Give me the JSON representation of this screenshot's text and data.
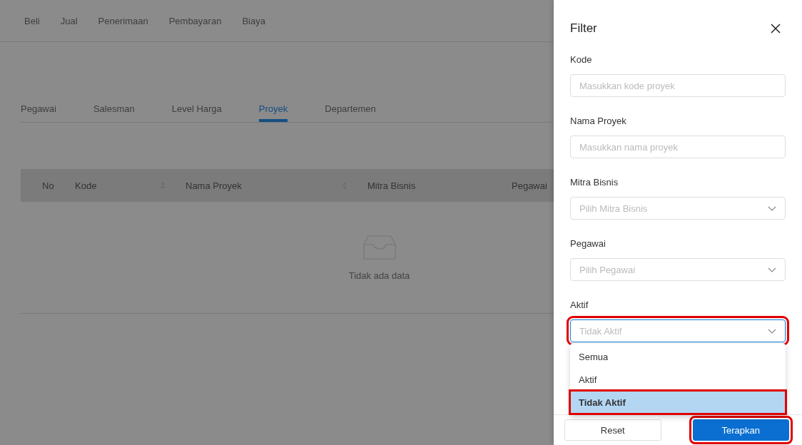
{
  "top_nav": [
    {
      "label": "Beli"
    },
    {
      "label": "Jual"
    },
    {
      "label": "Penerimaan"
    },
    {
      "label": "Pembayaran"
    },
    {
      "label": "Biaya"
    }
  ],
  "tabs": [
    {
      "label": "Pegawai",
      "selected": false
    },
    {
      "label": "Salesman",
      "selected": false
    },
    {
      "label": "Level Harga",
      "selected": false
    },
    {
      "label": "Proyek",
      "selected": true
    },
    {
      "label": "Departemen",
      "selected": false
    }
  ],
  "table": {
    "columns": [
      {
        "label": "No",
        "sortable": false
      },
      {
        "label": "Kode",
        "sortable": true
      },
      {
        "label": "Nama Proyek",
        "sortable": true
      },
      {
        "label": "Mitra Bisnis",
        "sortable": false
      },
      {
        "label": "Pegawai"
      }
    ],
    "empty_text": "Tidak ada data"
  },
  "filter": {
    "title": "Filter",
    "fields": [
      {
        "kind": "input",
        "label": "Kode",
        "placeholder": "Masukkan kode proyek"
      },
      {
        "kind": "input",
        "label": "Nama Proyek",
        "placeholder": "Masukkan nama proyek"
      },
      {
        "kind": "select",
        "label": "Mitra Bisnis",
        "placeholder": "Pilih Mitra Bisnis",
        "open": false,
        "highlighted": false
      },
      {
        "kind": "select",
        "label": "Pegawai",
        "placeholder": "Pilih Pegawai",
        "open": false,
        "highlighted": false
      },
      {
        "kind": "select",
        "label": "Aktif",
        "placeholder": "Tidak Aktif",
        "open": true,
        "highlighted": true
      }
    ],
    "options": [
      {
        "label": "Semua",
        "selected": false,
        "highlighted": false
      },
      {
        "label": "Aktif",
        "selected": false,
        "highlighted": false
      },
      {
        "label": "Tidak Aktif",
        "selected": true,
        "highlighted": true
      }
    ],
    "buttons": [
      {
        "label": "Reset",
        "kind": "secondary",
        "highlighted": false
      },
      {
        "label": "Terapkan",
        "kind": "primary",
        "highlighted": true
      }
    ]
  }
}
